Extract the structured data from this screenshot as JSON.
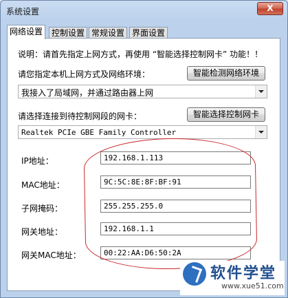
{
  "window": {
    "title": "系统设置",
    "close_label": "X"
  },
  "tabs": [
    "网络设置",
    "控制设置",
    "常规设置",
    "界面设置"
  ],
  "network": {
    "notice": "说明：请首先指定上网方式，再使用 “智能选择控制网卡” 功能！！",
    "access_label": "请您指定本机上网方式及网络环境：",
    "detect_button": "智能检测网络环境",
    "access_value": "我接入了局域网，并通过路由器上网",
    "nic_label": "请选择连接到待控制网段的网卡：",
    "nic_button": "智能选择控制网卡",
    "nic_value": "Realtek PCIe GBE Family Controller"
  },
  "fields": [
    {
      "label": "IP地址：",
      "value": "192.168.1.113"
    },
    {
      "label": "MAC地址：",
      "value": "9C:5C:8E:8F:BF:91"
    },
    {
      "label": "子网掩码：",
      "value": "255.255.255.0"
    },
    {
      "label": "网关地址：",
      "value": "192.168.1.1"
    },
    {
      "label": "网关MAC地址：",
      "value": "00:22:AA:D6:50:2A"
    }
  ],
  "watermark": {
    "title": "软件学堂",
    "url": "www.xue51.com"
  }
}
